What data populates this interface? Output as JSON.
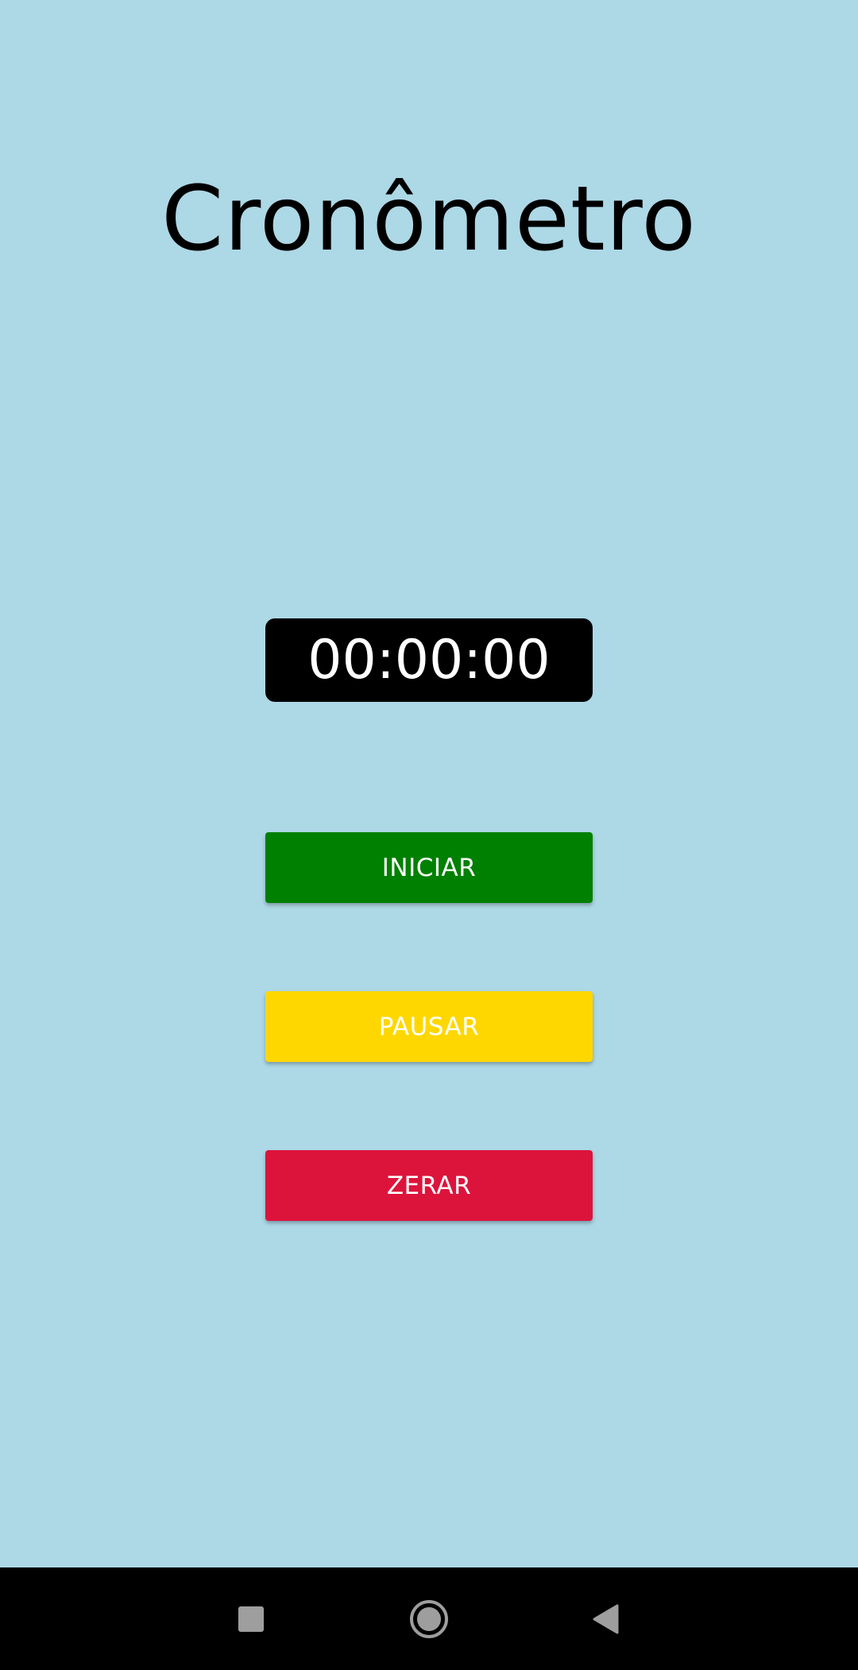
{
  "app": {
    "title": "Cronômetro",
    "timer_display": "00:00:00"
  },
  "buttons": {
    "start_label": "INICIAR",
    "pause_label": "PAUSAR",
    "reset_label": "ZERAR"
  },
  "colors": {
    "background": "#ADD8E6",
    "timer_bg": "#000000",
    "start": "#008000",
    "pause": "#FFD700",
    "reset": "#DC143C",
    "navbar": "#000000"
  },
  "navbar": {
    "icons": [
      "recents-square-icon",
      "home-circle-icon",
      "back-triangle-icon"
    ]
  }
}
